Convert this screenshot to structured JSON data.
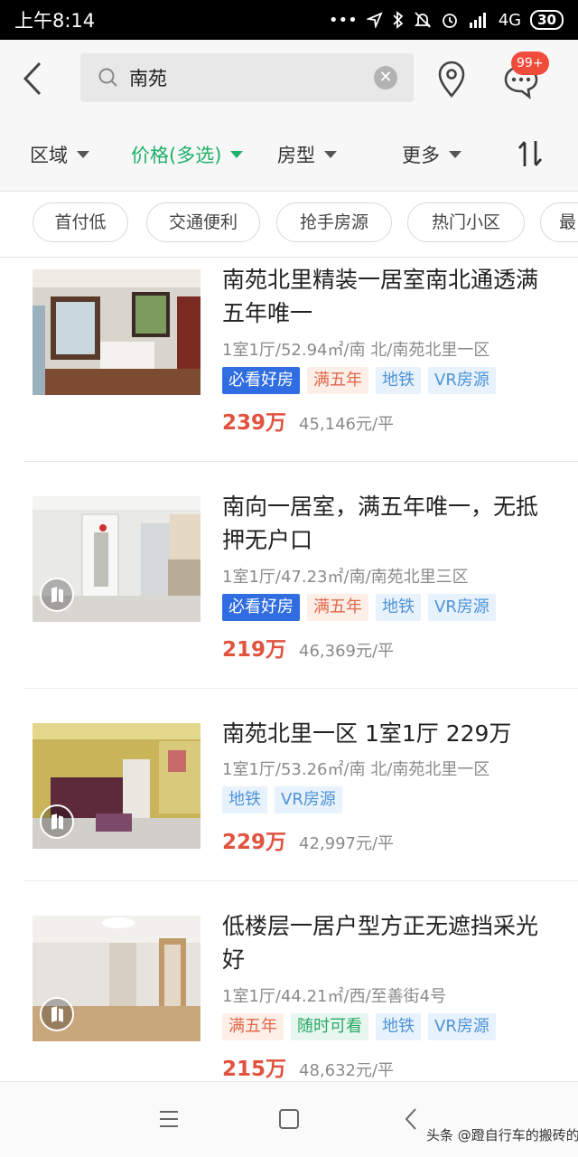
{
  "status_bar": {
    "time": "上午8:14",
    "network": "4G",
    "battery": "30"
  },
  "search": {
    "value": "南苑"
  },
  "header": {
    "message_badge": "99+"
  },
  "filters": [
    {
      "label": "区域",
      "active": false
    },
    {
      "label": "价格(多选)",
      "active": true
    },
    {
      "label": "房型",
      "active": false
    },
    {
      "label": "更多",
      "active": false
    }
  ],
  "quick_tags": [
    "首付低",
    "交通便利",
    "抢手房源",
    "热门小区",
    "最"
  ],
  "listings": [
    {
      "title": "南苑北里精装一居室南北通透满五年唯一",
      "meta": "1室1厅/52.94㎡/南 北/南苑北里一区",
      "tags": [
        "必看好房",
        "满五年",
        "地铁",
        "VR房源"
      ],
      "price": "239万",
      "unit_price": "45,146元/平"
    },
    {
      "title": "南向一居室，满五年唯一，无抵押无户口",
      "meta": "1室1厅/47.23㎡/南/南苑北里三区",
      "tags": [
        "必看好房",
        "满五年",
        "地铁",
        "VR房源"
      ],
      "price": "219万",
      "unit_price": "46,369元/平"
    },
    {
      "title": "南苑北里一区 1室1厅 229万",
      "meta": "1室1厅/53.26㎡/南 北/南苑北里一区",
      "tags": [
        "地铁",
        "VR房源"
      ],
      "price": "229万",
      "unit_price": "42,997元/平"
    },
    {
      "title": "低楼层一居户型方正无遮挡采光好",
      "meta": "1室1厅/44.21㎡/西/至善街4号",
      "tags": [
        "满五年",
        "随时可看",
        "地铁",
        "VR房源"
      ],
      "price": "215万",
      "unit_price": "48,632元/平"
    }
  ],
  "watermark": "头条 @蹬自行车的搬砖的",
  "colors": {
    "accent_green": "#1fb06a",
    "price_red": "#e0533f",
    "badge_red": "#f04b3b",
    "tag_blue": "#2f6de0"
  }
}
